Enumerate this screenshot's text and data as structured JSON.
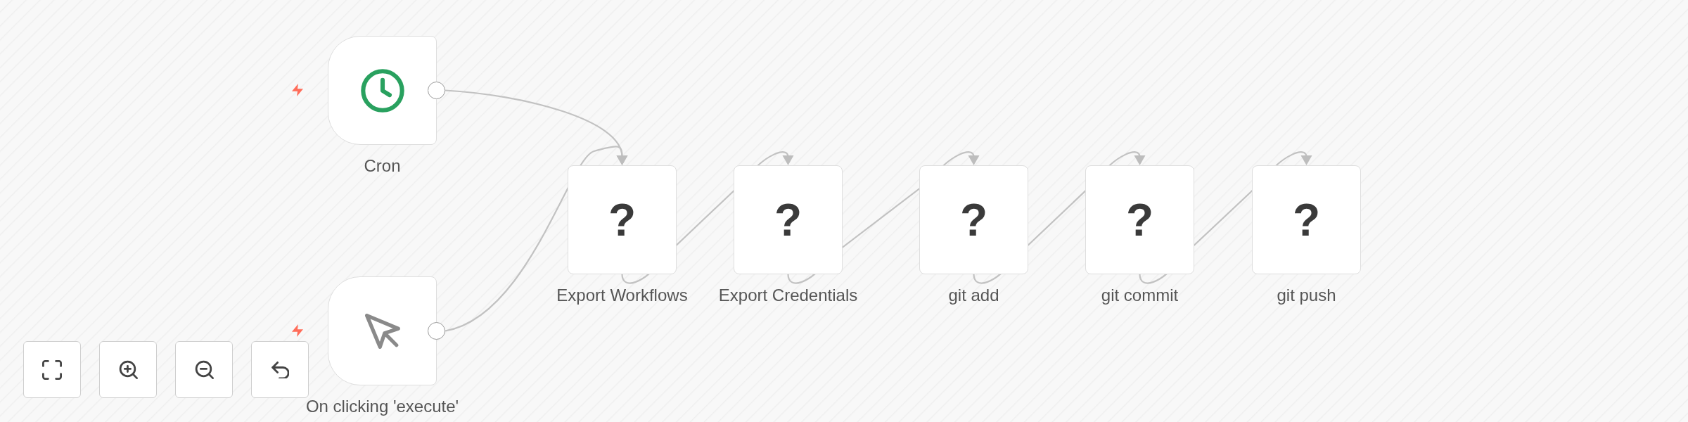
{
  "triggers": [
    {
      "kind": "schedule",
      "label": "Cron"
    },
    {
      "kind": "manual",
      "label": "On clicking 'execute'"
    }
  ],
  "nodes": [
    {
      "glyph": "?",
      "label": "Export Workflows"
    },
    {
      "glyph": "?",
      "label": "Export Credentials"
    },
    {
      "glyph": "?",
      "label": "git add"
    },
    {
      "glyph": "?",
      "label": "git commit"
    },
    {
      "glyph": "?",
      "label": "git push"
    }
  ],
  "canvas_controls": [
    {
      "kind": "fit_view"
    },
    {
      "kind": "zoom_in"
    },
    {
      "kind": "zoom_out"
    },
    {
      "kind": "reset_zoom"
    }
  ]
}
